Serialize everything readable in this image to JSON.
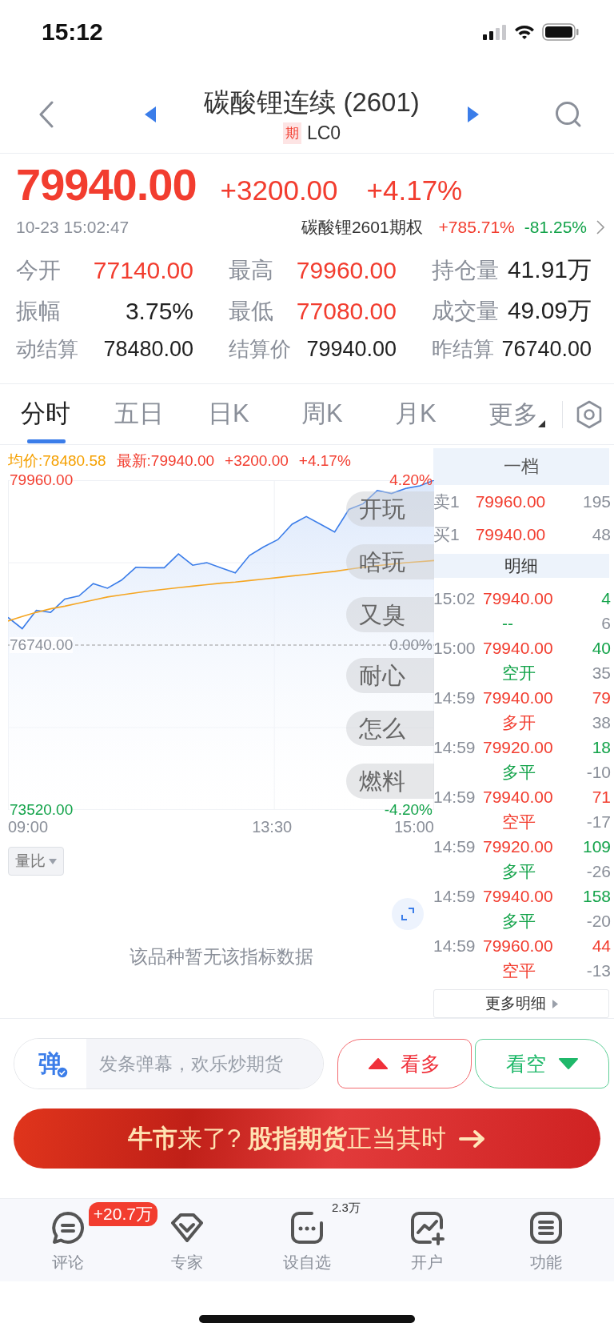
{
  "status_bar": {
    "time": "15:12"
  },
  "header": {
    "title": "碳酸锂连续 (2601)",
    "tag": "期",
    "code": "LC0"
  },
  "quote": {
    "price": "79940.00",
    "change": "+3200.00",
    "change_pct": "+4.17%",
    "color": "#f23d2f",
    "timestamp": "10-23 15:02:47",
    "option": {
      "name": "碳酸锂2601期权",
      "changes": [
        {
          "text": "+785.71%",
          "color": "#f23d2f"
        },
        {
          "text": "-81.25%",
          "color": "#13a34a"
        }
      ]
    },
    "stats": [
      {
        "label": "今开",
        "value": "77140.00",
        "color": "#f23d2f"
      },
      {
        "label": "最高",
        "value": "79960.00",
        "color": "#f23d2f"
      },
      {
        "label": "持仓量",
        "value": "41.91万",
        "color": "#222222"
      },
      {
        "label": "振幅",
        "value": "3.75%",
        "color": "#222222"
      },
      {
        "label": "最低",
        "value": "77080.00",
        "color": "#f23d2f"
      },
      {
        "label": "成交量",
        "value": "49.09万",
        "color": "#222222"
      },
      {
        "label": "动结算",
        "value": "78480.00",
        "color": "#222222"
      },
      {
        "label": "结算价",
        "value": "79940.00",
        "color": "#222222"
      },
      {
        "label": "昨结算",
        "value": "76740.00",
        "color": "#222222"
      }
    ]
  },
  "tabs": [
    {
      "label": "分时",
      "selected": true,
      "kind": "tab"
    },
    {
      "label": "五日",
      "selected": false,
      "kind": "tab"
    },
    {
      "label": "日K",
      "selected": false,
      "kind": "tab"
    },
    {
      "label": "周K",
      "selected": false,
      "kind": "tab"
    },
    {
      "label": "月K",
      "selected": false,
      "kind": "tab"
    },
    {
      "label": "更多",
      "selected": false,
      "kind": "dropdown"
    }
  ],
  "intraday": {
    "legend": [
      {
        "label": "均价:78480.58",
        "kind": "avg"
      },
      {
        "label": "最新:79940.00",
        "kind": "last"
      },
      {
        "label": "+3200.00",
        "kind": "last"
      },
      {
        "label": "+4.17%",
        "kind": "last"
      }
    ],
    "chart_data": {
      "type": "line",
      "ylim": [
        73520,
        79960
      ],
      "yticks": [
        {
          "value": 79960,
          "label": "79960.00"
        },
        {
          "value": 76740,
          "label": "76740.00"
        },
        {
          "value": 73520,
          "label": "73520.00"
        }
      ],
      "series": [
        {
          "color": "#3b7de9",
          "values": [
            77280,
            77060,
            77420,
            77380,
            77640,
            77700,
            77940,
            77850,
            78010,
            78260,
            78250,
            78250,
            78520,
            78300,
            78350,
            78250,
            78150,
            78490,
            78660,
            78800,
            79100,
            79250,
            79100,
            78950,
            79390,
            79500,
            79760,
            79700,
            79800,
            79850,
            79960
          ]
        },
        {
          "color": "#f5a623",
          "values": [
            77210,
            77300,
            77380,
            77450,
            77500,
            77560,
            77620,
            77680,
            77720,
            77760,
            77800,
            77830,
            77860,
            77890,
            77920,
            77950,
            77970,
            78000,
            78030,
            78060,
            78090,
            78120,
            78150,
            78180,
            78220,
            78260,
            78290,
            78320,
            78350,
            78370,
            78390
          ]
        }
      ]
    },
    "time_labels": [
      "09:00",
      "13:30",
      "15:00"
    ],
    "pct_labels": [
      "4.20%",
      "0.00%",
      "-4.20%"
    ],
    "danmaku": [
      "开玩",
      "啥玩",
      "又臭",
      "耐心",
      "怎么",
      "燃料"
    ],
    "indicator": "量比",
    "no_data": "该品种暂无该指标数据"
  },
  "order_book": {
    "title": "一档",
    "levels": [
      {
        "side": "卖1",
        "price": "79960.00",
        "volume": "195"
      },
      {
        "side": "买1",
        "price": "79940.00",
        "volume": "48"
      }
    ]
  },
  "trades": {
    "title": "明细",
    "more": "更多明细",
    "rows": [
      {
        "time": "15:02",
        "price": "79940.00",
        "volume": "4",
        "action": "--",
        "color": "#13a34a",
        "change": "6"
      },
      {
        "time": "15:00",
        "price": "79940.00",
        "volume": "40",
        "action": "空开",
        "color": "#13a34a",
        "change": "35"
      },
      {
        "time": "14:59",
        "price": "79940.00",
        "volume": "79",
        "action": "多开",
        "color": "#f23d2f",
        "change": "38"
      },
      {
        "time": "14:59",
        "price": "79920.00",
        "volume": "18",
        "action": "多平",
        "color": "#13a34a",
        "change": "-10"
      },
      {
        "time": "14:59",
        "price": "79940.00",
        "volume": "71",
        "action": "空平",
        "color": "#f23d2f",
        "change": "-17"
      },
      {
        "time": "14:59",
        "price": "79920.00",
        "volume": "109",
        "action": "多平",
        "color": "#13a34a",
        "change": "-26"
      },
      {
        "time": "14:59",
        "price": "79940.00",
        "volume": "158",
        "action": "多平",
        "color": "#13a34a",
        "change": "-20"
      },
      {
        "time": "14:59",
        "price": "79960.00",
        "volume": "44",
        "action": "空平",
        "color": "#f23d2f",
        "change": "-13"
      }
    ]
  },
  "danmaku_bar": {
    "glyph": "弹",
    "placeholder": "发条弹幕，欢乐炒期货"
  },
  "votes": [
    {
      "label": "看多",
      "kind": "bull"
    },
    {
      "label": "看空",
      "kind": "bear"
    }
  ],
  "banner": {
    "text": "**牛市**来了? **股指期货**正当其时"
  },
  "bottom_nav": [
    {
      "label": "评论",
      "kind": "comment",
      "badge": "+20.7万"
    },
    {
      "label": "专家",
      "kind": "expert"
    },
    {
      "label": "设自选",
      "kind": "watch",
      "count": "2.3万"
    },
    {
      "label": "开户",
      "kind": "account"
    },
    {
      "label": "功能",
      "kind": "menu"
    }
  ]
}
